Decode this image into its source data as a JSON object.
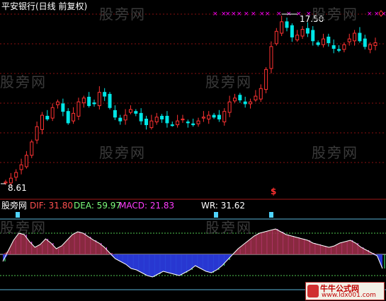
{
  "title": "平安银行(日线 前复权)",
  "price_high_label": "17.50",
  "price_low_label": "8.61",
  "watermark": "股旁网",
  "indicators": {
    "panel_name": "股旁网",
    "dif": "DIF: 31.80",
    "dea": "DEA: 59.97",
    "macd": "MACD: 21.83",
    "wr": "WR: 31.62"
  },
  "signal_glyph": "$",
  "logo": {
    "line1": "牛牛公式网",
    "line2": "www.ldx001.com"
  },
  "colors": {
    "up": "#ff3232",
    "down": "#00e6e6",
    "marker": "#ff00ff",
    "dif": "#ff5050",
    "dea": "#ffffff",
    "fill_up": "#a0304a",
    "fill_down": "#2a3adc"
  },
  "chart_data": {
    "type": "candlestick",
    "title": "平安银行(日线 前复权)",
    "y_range": [
      8.61,
      17.5
    ],
    "annotations": [
      {
        "text": "17.50",
        "value": 17.5
      },
      {
        "text": "8.61",
        "value": 8.61
      }
    ],
    "close_series": [
      8.7,
      8.9,
      9.2,
      9.6,
      10.1,
      10.8,
      11.6,
      12.2,
      12.0,
      12.6,
      12.9,
      12.4,
      11.8,
      12.3,
      12.9,
      13.1,
      12.7,
      12.8,
      13.4,
      13.2,
      12.6,
      12.1,
      11.9,
      12.2,
      12.5,
      12.3,
      11.9,
      11.7,
      11.9,
      12.1,
      12.0,
      11.8,
      11.7,
      11.9,
      12.0,
      11.8,
      11.7,
      11.9,
      12.1,
      12.2,
      12.1,
      12.0,
      12.4,
      12.9,
      13.1,
      13.0,
      12.8,
      12.9,
      13.2,
      13.6,
      14.6,
      15.8,
      16.6,
      17.1,
      16.8,
      16.3,
      16.4,
      16.7,
      16.5,
      16.1,
      15.9,
      16.2,
      16.0,
      15.7,
      15.6,
      15.9,
      16.2,
      16.5,
      16.1,
      15.8,
      15.9,
      16.0
    ],
    "indicator_panel": {
      "series": [
        {
          "name": "DIF",
          "value": 31.8
        },
        {
          "name": "DEA",
          "value": 59.97
        },
        {
          "name": "MACD",
          "value": 21.83
        },
        {
          "name": "WR",
          "value": 31.62
        }
      ],
      "wr_values": [
        40,
        55,
        70,
        80,
        78,
        68,
        60,
        64,
        72,
        66,
        58,
        62,
        70,
        78,
        82,
        80,
        75,
        70,
        66,
        60,
        52,
        44,
        40,
        36,
        30,
        28,
        24,
        20,
        18,
        22,
        26,
        24,
        22,
        20,
        24,
        28,
        34,
        30,
        26,
        24,
        28,
        34,
        42,
        50,
        58,
        64,
        70,
        76,
        80,
        82,
        84,
        86,
        82,
        78,
        76,
        74,
        72,
        70,
        66,
        64,
        62,
        60,
        62,
        66,
        68,
        70,
        66,
        60,
        56,
        52,
        48,
        30
      ]
    }
  }
}
